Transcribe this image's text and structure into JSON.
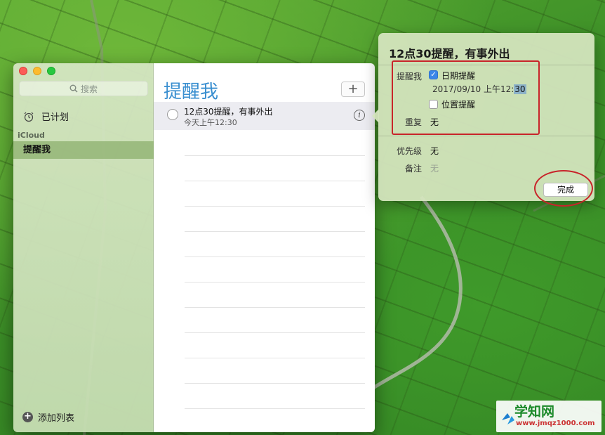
{
  "window": {
    "search_placeholder": "搜索",
    "sidebar": {
      "scheduled_label": "已计划",
      "section_label": "iCloud",
      "selected_list": "提醒我",
      "add_list_label": "添加列表"
    },
    "main": {
      "title": "提醒我",
      "add_button": "+",
      "reminder": {
        "title": "12点30提醒，有事外出",
        "subtitle": "今天上午12:30",
        "info_icon": "ⓘ"
      }
    }
  },
  "popover": {
    "title": "12点30提醒，有事外出",
    "remind_label": "提醒我",
    "date_reminder_label": "日期提醒",
    "date_reminder_checked": true,
    "date_value_prefix": "2017/09/10 上午12:",
    "date_value_selected": "30",
    "location_reminder_label": "位置提醒",
    "location_reminder_checked": false,
    "repeat_label": "重复",
    "repeat_value": "无",
    "priority_label": "优先级",
    "priority_value": "无",
    "note_label": "备注",
    "note_value": "无",
    "done_button": "完成"
  },
  "watermark": {
    "name": "学知网",
    "url": "www.jmqz1000.com"
  },
  "colors": {
    "accent_title": "#3a8fd0",
    "annotation_red": "#c8242a",
    "checkbox_blue": "#3b86e8"
  }
}
